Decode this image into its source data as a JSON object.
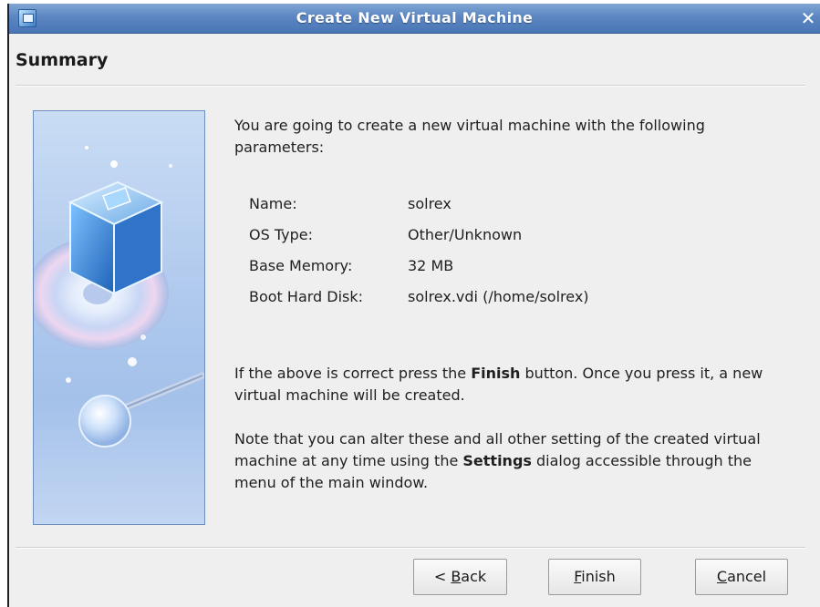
{
  "window": {
    "title": "Create New Virtual Machine",
    "close_glyph": "✕"
  },
  "page": {
    "heading": "Summary"
  },
  "intro_text": "You are going to create a new virtual machine with the following parameters:",
  "parameters": [
    {
      "label": "Name:",
      "value": "solrex"
    },
    {
      "label": "OS Type:",
      "value": "Other/Unknown"
    },
    {
      "label": "Base Memory:",
      "value": "32 MB"
    },
    {
      "label": "Boot Hard Disk:",
      "value": "solrex.vdi (/home/solrex)"
    }
  ],
  "paragraph1": {
    "before": "If the above is correct press the ",
    "bold": "Finish",
    "after": " button. Once you press it, a new virtual machine will be created."
  },
  "paragraph2": {
    "before": "Note that you can alter these and all other setting of the created virtual machine at any time using the ",
    "bold": "Settings",
    "after": " dialog accessible through the menu of the main window."
  },
  "buttons": {
    "back": {
      "prefix": "< ",
      "mnemonic": "B",
      "rest": "ack"
    },
    "finish": {
      "prefix": "",
      "mnemonic": "F",
      "rest": "inish"
    },
    "cancel": {
      "prefix": "",
      "mnemonic": "C",
      "rest": "ancel"
    }
  },
  "colors": {
    "titlebar": "#5b86c2",
    "dialog_bg": "#efefef",
    "illustration_bg": "#b2cbee"
  },
  "icons": {
    "app": "virtualbox-app-icon",
    "close": "close-icon",
    "illustration": "virtualbox-cube-disc-illustration"
  }
}
